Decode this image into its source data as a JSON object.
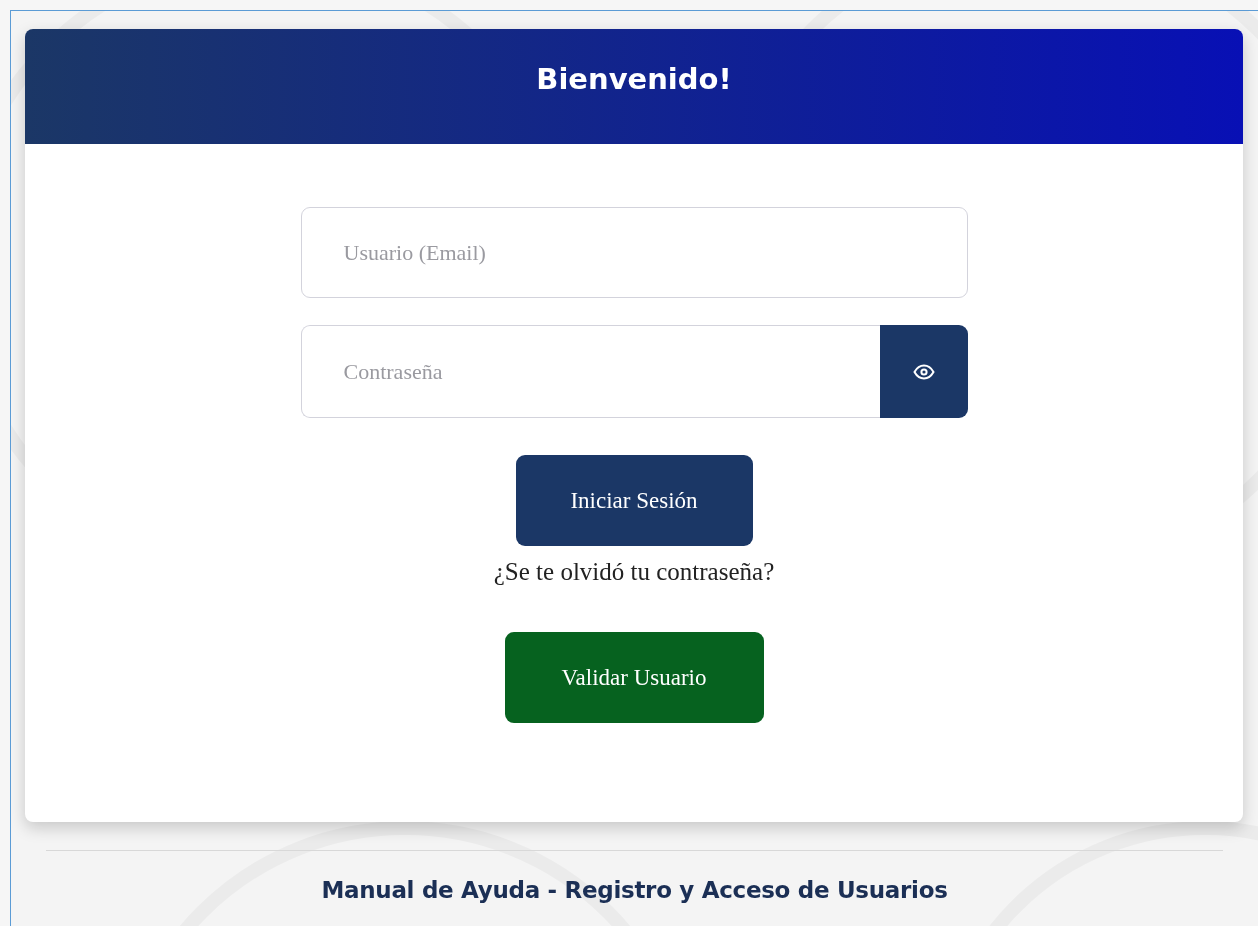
{
  "card": {
    "title": "Bienvenido!",
    "username": {
      "placeholder": "Usuario (Email)"
    },
    "password": {
      "placeholder": "Contraseña"
    },
    "login_button": "Iniciar Sesión",
    "forgot_link": "¿Se te olvidó tu contraseña?",
    "validate_button": "Validar Usuario"
  },
  "footer": {
    "link": "Manual de Ayuda - Registro y Acceso de Usuarios"
  }
}
